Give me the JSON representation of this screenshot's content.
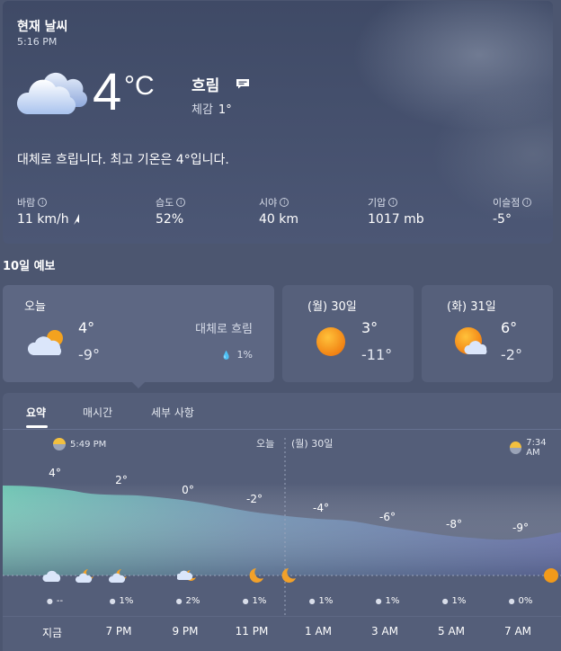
{
  "current": {
    "title": "현재 날씨",
    "time": "5:16 PM",
    "icon": "cloudy-icon",
    "temp": "4",
    "unit": "°C",
    "condition": "흐림",
    "feels_label": "체감",
    "feels_value": "1°",
    "summary": "대체로 흐립니다. 최고 기온은 4°입니다.",
    "stats": [
      {
        "label": "바람",
        "value": "11 km/h"
      },
      {
        "label": "습도",
        "value": "52%"
      },
      {
        "label": "시야",
        "value": "40 km"
      },
      {
        "label": "기압",
        "value": "1017 mb"
      },
      {
        "label": "이슬점",
        "value": "-5°"
      }
    ]
  },
  "forecast": {
    "title": "10일 예보",
    "days": [
      {
        "name": "오늘",
        "hi": "4°",
        "lo": "-9°",
        "condition": "대체로 흐림",
        "precip": "1%",
        "icon": "partly-cloudy-icon"
      },
      {
        "name": "(월) 30일",
        "hi": "3°",
        "lo": "-11°",
        "icon": "sunny-icon"
      },
      {
        "name": "(화) 31일",
        "hi": "6°",
        "lo": "-2°",
        "icon": "partly-sunny-icon"
      }
    ]
  },
  "detail": {
    "tabs": [
      "요약",
      "매시간",
      "세부 사항"
    ],
    "sunset": "5:49 PM",
    "sunrise": "7:34 AM",
    "today_label": "오늘",
    "next_day_label": "(월) 30일",
    "points": [
      {
        "temp": "4°",
        "precip": "--",
        "time": "지금",
        "icon": "cloudy-icon"
      },
      {
        "temp": "2°",
        "precip": "1%",
        "time": "7 PM",
        "icon": "partly-cloudy-night-icon"
      },
      {
        "temp": "0°",
        "precip": "2%",
        "time": "9 PM",
        "icon": "cloudy-night-icon"
      },
      {
        "temp": "-2°",
        "precip": "1%",
        "time": "11 PM",
        "icon": "moon-icon"
      },
      {
        "temp": "-4°",
        "precip": "1%",
        "time": "1 AM",
        "icon": "moon-icon"
      },
      {
        "temp": "-6°",
        "precip": "1%",
        "time": "3 AM",
        "icon": "none"
      },
      {
        "temp": "-8°",
        "precip": "1%",
        "time": "5 AM",
        "icon": "none"
      },
      {
        "temp": "-9°",
        "precip": "0%",
        "time": "7 AM",
        "icon": "sun-icon"
      }
    ]
  },
  "colors": {
    "background": "#4c5670",
    "card": "#56607b",
    "selected_card": "#5d6783",
    "chart_top": "#6fc5b3",
    "chart_bottom": "#5a65a6",
    "sun": "#f29a1a"
  }
}
